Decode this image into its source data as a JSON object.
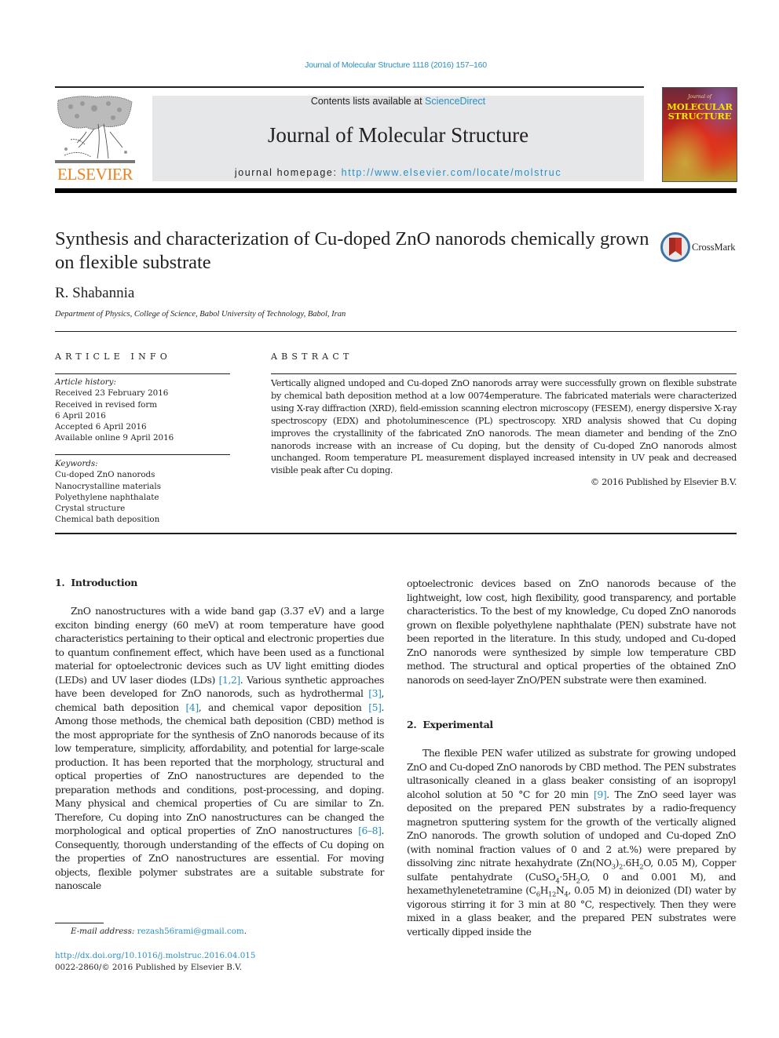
{
  "running_head": "Journal of Molecular Structure 1118 (2016) 157–160",
  "masthead": {
    "publisher_logo_text": "ELSEVIER",
    "contents_prefix": "Contents lists available at ",
    "contents_link": "ScienceDirect",
    "journal_title": "Journal of Molecular Structure",
    "homepage_prefix": "journal homepage: ",
    "homepage_url": "http://www.elsevier.com/locate/molstruc",
    "cover": {
      "pre_title": "Journal of",
      "title_line1": "MOLECULAR",
      "title_line2": "STRUCTURE"
    }
  },
  "article": {
    "title": "Synthesis and characterization of Cu-doped ZnO nanorods chemically grown on flexible substrate",
    "crossmark_label": "CrossMark",
    "author": "R. Shabannia",
    "affiliation": "Department of Physics, College of Science, Babol University of Technology, Babol, Iran"
  },
  "article_info": {
    "heading": "ARTICLE INFO",
    "history_label": "Article history:",
    "history": [
      "Received 23 February 2016",
      "Received in revised form",
      "6 April 2016",
      "Accepted 6 April 2016",
      "Available online 9 April 2016"
    ],
    "keywords_label": "Keywords:",
    "keywords": [
      "Cu-doped ZnO nanorods",
      "Nanocrystalline materials",
      "Polyethylene naphthalate",
      "Crystal structure",
      "Chemical bath deposition"
    ]
  },
  "abstract": {
    "heading": "ABSTRACT",
    "text": "Vertically aligned undoped and Cu-doped ZnO nanorods array were successfully grown on flexible substrate by chemical bath deposition method at a low 0074emperature. The fabricated materials were characterized using X-ray diffraction (XRD), field-emission scanning electron microscopy (FESEM), en­ergy dispersive X-ray spectroscopy (EDX) and photoluminescence (PL) spectroscopy. XRD analysis showed that Cu doping improves the crystallinity of the fabricated ZnO nanorods. The mean diameter and bending of the ZnO nanorods increase with an increase of Cu doping, but the density of Cu-doped ZnO nanorods almost unchanged. Room temperature PL measurement displayed increased intensity in UV peak and decreased visible peak after Cu doping.",
    "copyright": "© 2016 Published by Elsevier B.V."
  },
  "body": {
    "section1_heading": "1.  Introduction",
    "intro": {
      "t1": "ZnO nanostructures with a wide band gap (3.37 eV) and a large exciton binding energy (60 meV) at room temperature have good characteristics pertaining to their optical and electronic properties due to quantum confinement effect, which have been used as a functional material for optoelectronic devices such as UV light emitting diodes (LEDs) and UV laser diodes (LDs) ",
      "r1": "[1,2]",
      "t2": ". Various synthetic approaches have been developed for ZnO nanorods, such as hydrothermal ",
      "r2": "[3]",
      "t3": ", chemical bath deposition ",
      "r3": "[4]",
      "t4": ", and chemical vapor deposition ",
      "r4": "[5]",
      "t5": ". Among those methods, the chemical bath deposition (CBD) method is the most appropriate for the synthesis of ZnO nanorods because of its low temperature, simplicity, affordability, and potential for large-scale production. It has been reported that the morphology, structural and optical properties of ZnO nanostructures are depended to the preparation methods and conditions, post-processing, and doping. Many physical and chemical properties of Cu are similar to Zn. Therefore, Cu doping into ZnO nanostructures can be changed the morphological and optical properties of ZnO nanostructures ",
      "r5": "[6–8]",
      "t6": ". Consequently, thorough understanding of the effects of Cu doping on the prop­erties of ZnO nanostructures are essential. For moving objects, flexible polymer substrates are a suitable substrate for nanoscale",
      "t7": "optoelectronic devices based on ZnO nanorods because of the lightweight, low cost, high flexibility, good transparency, and portable characteristics. To the best of my knowledge, Cu doped ZnO nanorods grown on flexible polyethylene naphthalate (PEN) substrate have not been reported in the literature. In this study, undoped and Cu-doped ZnO nanorods were synthesized by simple low temperature CBD method. The structural and optical properties of the obtained ZnO nanorods on seed-layer ZnO/PEN substrate were then examined."
    },
    "section2_heading": "2.  Experimental",
    "experimental": {
      "t1": "The flexible PEN wafer utilized as substrate for growing undo­ped ZnO and Cu-doped ZnO nanorods by CBD method. The PEN substrates ultrasonically cleaned in a glass beaker consisting of an isopropyl alcohol solution at 50 °C for 20 min ",
      "r1": "[9]",
      "t2": ". The ZnO seed layer was deposited on the prepared PEN substrates by a radio-frequency magnetron sputtering system for the growth of the vertically aligned ZnO nanorods. The growth solution of undoped and Cu-doped ZnO (with nominal fraction values of 0 and 2 at.%) were prepared by dissolving zinc nitrate hexahydrate (Zn(NO",
      "s1": "3",
      "t3": ")",
      "s2": "2",
      "t4": ".6H",
      "s3": "2",
      "t5": "O, 0.05 M), Copper sulfate pentahydrate (CuSO",
      "s4": "4",
      "t6": "·5H",
      "s5": "2",
      "t7": "O, 0 and 0.001 M), and hexamethylenetetramine (C",
      "s6": "6",
      "t8": "H",
      "s7": "12",
      "t9": "N",
      "s8": "4",
      "t10": ", 0.05 M) in deionized (DI) water by vigorous stirring it for 3 min at 80 °C, respectively. Then they were mixed in a glass beaker, and the prepared PEN substrates were vertically dipped inside the"
    }
  },
  "footer": {
    "email_label": "E-mail address: ",
    "email": "rezash56rami@gmail.com",
    "email_suffix": ".",
    "doi": "http://dx.doi.org/10.1016/j.molstruc.2016.04.015",
    "issn_line": "0022-2860/© 2016 Published by Elsevier B.V."
  },
  "colors": {
    "link": "#2a8fc4",
    "elsevier_orange": "#f07f1a",
    "masthead_gray": "#e6e7e8",
    "text": "#231f20"
  }
}
